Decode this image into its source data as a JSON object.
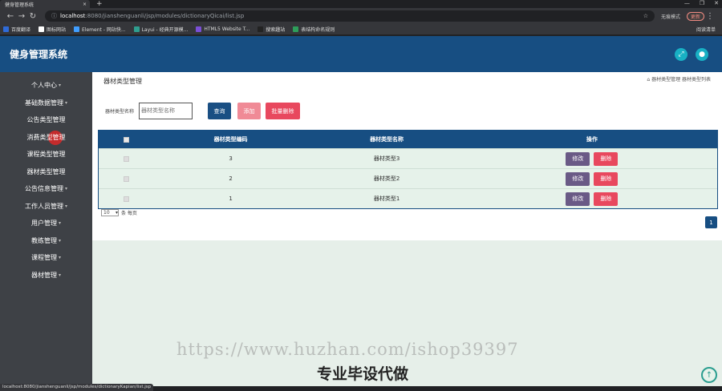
{
  "browser": {
    "tab_title": "健身管理系统",
    "tab_close": "×",
    "new_tab": "+",
    "url_host": "localhost",
    "url_path": ":8080/jianshenguanli/jsp/modules/dictionaryQicai/list.jsp",
    "incognito_label": "无痕模式",
    "update_label": "更新",
    "bookmarks": [
      {
        "label": "百度翻译",
        "color": "#2f6bd8"
      },
      {
        "label": "图标网站",
        "color": "#ffffff"
      },
      {
        "label": "Element - 网站快...",
        "color": "#409eff"
      },
      {
        "label": "Layui - 经典开源模...",
        "color": "#2f9e8f"
      },
      {
        "label": "HTML5 Website T...",
        "color": "#7b4fd6"
      },
      {
        "label": "搜索趣站",
        "color": "#222222"
      },
      {
        "label": "表结构命名规则",
        "color": "#2e9e5a"
      }
    ],
    "reading_list": "阅读清单",
    "status_url": "localhost:8080/jianshenguanli/jsp/modules/dictionaryKapian/list.jsp"
  },
  "app": {
    "title": "健身管理系统"
  },
  "sidebar": {
    "items": [
      {
        "label": "个人中心",
        "caret": true
      },
      {
        "label": "基础数据管理",
        "caret": true
      },
      {
        "label": "公告类型管理",
        "caret": false
      },
      {
        "label": "消费类型管理",
        "caret": false
      },
      {
        "label": "课程类型管理",
        "caret": false
      },
      {
        "label": "器材类型管理",
        "caret": false
      },
      {
        "label": "公告信息管理",
        "caret": true
      },
      {
        "label": "工作人员管理",
        "caret": true
      },
      {
        "label": "用户管理",
        "caret": true
      },
      {
        "label": "教练管理",
        "caret": true
      },
      {
        "label": "课程管理",
        "caret": true
      },
      {
        "label": "器材管理",
        "caret": true
      }
    ]
  },
  "main": {
    "page_title": "器材类型管理",
    "breadcrumb": "⌂ 器材类型管理 器材类型列表",
    "search_label": "器材类型名称",
    "search_placeholder": "器材类型名称",
    "query_button": "查询",
    "add_button": "添加",
    "batch_delete_button": "批量删除",
    "table": {
      "headers": {
        "code": "器材类型编码",
        "name": "器材类型名称",
        "op": "操作"
      },
      "rows": [
        {
          "code": "3",
          "name": "器材类型3"
        },
        {
          "code": "2",
          "name": "器材类型2"
        },
        {
          "code": "1",
          "name": "器材类型1"
        }
      ],
      "edit_label": "修改",
      "delete_label": "删除"
    },
    "page_size": "10",
    "page_size_suffix": "条 每页",
    "current_page": "1"
  },
  "overlay": {
    "watermark": "https://www.huzhan.com/ishop39397",
    "promo": "专业毕设代做"
  }
}
